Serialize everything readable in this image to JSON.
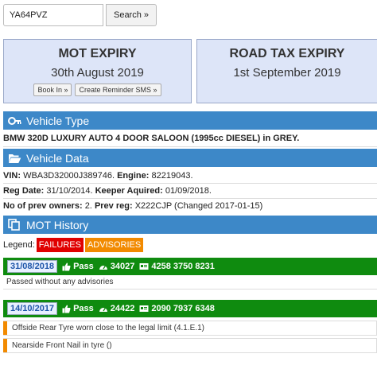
{
  "search": {
    "value": "YA64PVZ",
    "button_label": "Search »"
  },
  "mot_box": {
    "title": "MOT EXPIRY",
    "date": "30th August 2019",
    "book_label": "Book In »",
    "reminder_label": "Create Reminder SMS »"
  },
  "tax_box": {
    "title": "ROAD TAX EXPIRY",
    "date": "1st September 2019"
  },
  "vehicle_type": {
    "header": "Vehicle Type",
    "description": "BMW 320D LUXURY AUTO 4 DOOR SALOON (1995cc DIESEL) in GREY."
  },
  "vehicle_data": {
    "header": "Vehicle Data",
    "vin_label": "VIN:",
    "vin": "WBA3D32000J389746.",
    "engine_label": "Engine:",
    "engine": "82219043.",
    "reg_date_label": "Reg Date:",
    "reg_date": "31/10/2014.",
    "keeper_label": "Keeper Aquired:",
    "keeper": "01/09/2018.",
    "prev_owners_label": "No of prev owners:",
    "prev_owners": "2.",
    "prev_reg_label": "Prev reg:",
    "prev_reg": "X222CJP (Changed 2017-01-15)"
  },
  "mot_history": {
    "header": "MOT History",
    "legend_label": "Legend:",
    "failures_label": "FAILURES",
    "advisories_label": "ADVISORIES",
    "tests": [
      {
        "date": "31/08/2018",
        "result": "Pass",
        "mileage": "34027",
        "test_number": "4258 3750 8231",
        "note": "Passed without any advisories"
      },
      {
        "date": "14/10/2017",
        "result": "Pass",
        "mileage": "24422",
        "test_number": "2090 7937 6348",
        "advisories": [
          "Offside Rear Tyre worn close to the legal limit (4.1.E.1)",
          "Nearside Front Nail in tyre ()"
        ]
      }
    ]
  },
  "colors": {
    "section_header": "#3d88c8",
    "pass_bar": "#0f8b0f",
    "failures": "#e00000",
    "advisories": "#f28a00",
    "expiry_box": "#dde5f8"
  },
  "icons": {
    "search_button": "none",
    "vehicle_type": "key-icon",
    "vehicle_data": "folder-open-icon",
    "mot_history": "copy-icon",
    "result": "thumbs-up-icon",
    "mileage": "dashboard-icon",
    "test_number": "card-icon"
  }
}
